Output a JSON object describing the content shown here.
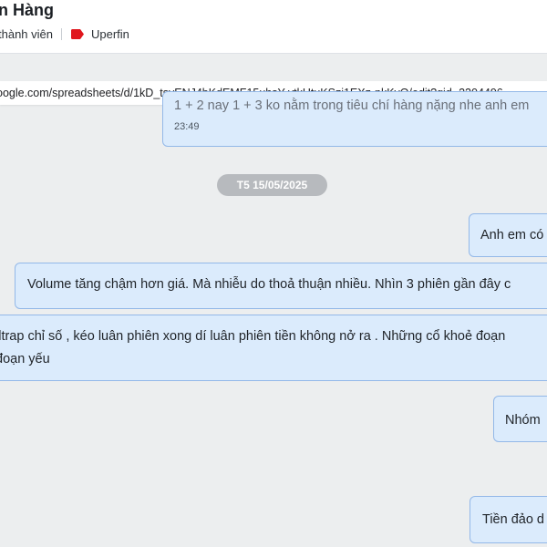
{
  "chat": {
    "title": "n Hàng",
    "members": "thành viên",
    "tag": "Uperfin",
    "tag_color": "#e0161d"
  },
  "browser": {
    "url": "oogle.com/spreadsheets/d/1kD_tsyENJ4bKdEMF15uhsY-vtkHtuKSzi1EXz-nkKvQ/edit?gid=2204496"
  },
  "messages": [
    {
      "text": "1 + 2 nay 1 + 3 ko nằm trong tiêu chí hàng nặng nhe anh em",
      "time": "23:49"
    },
    {
      "text": "Anh em có"
    },
    {
      "text": "Volume tăng chậm hơn giá. Mà nhiễu do thoả thuận nhiều. Nhìn 3 phiên gần đây c"
    },
    {
      "line1": "lltrap chỉ số , kéo luân phiên xong dí luân phiên tiền không nở ra . Những cổ khoẻ đoạn",
      "line2": "đoạn yếu"
    },
    {
      "text": "Nhóm"
    },
    {
      "text": "Tiền đảo d"
    }
  ],
  "date_separator": "T5 15/05/2025",
  "colors": {
    "bubble_bg": "#dbebfc",
    "bubble_border": "#93b8e8",
    "chat_bg": "#eceeef",
    "date_pill": "#b7babe"
  }
}
